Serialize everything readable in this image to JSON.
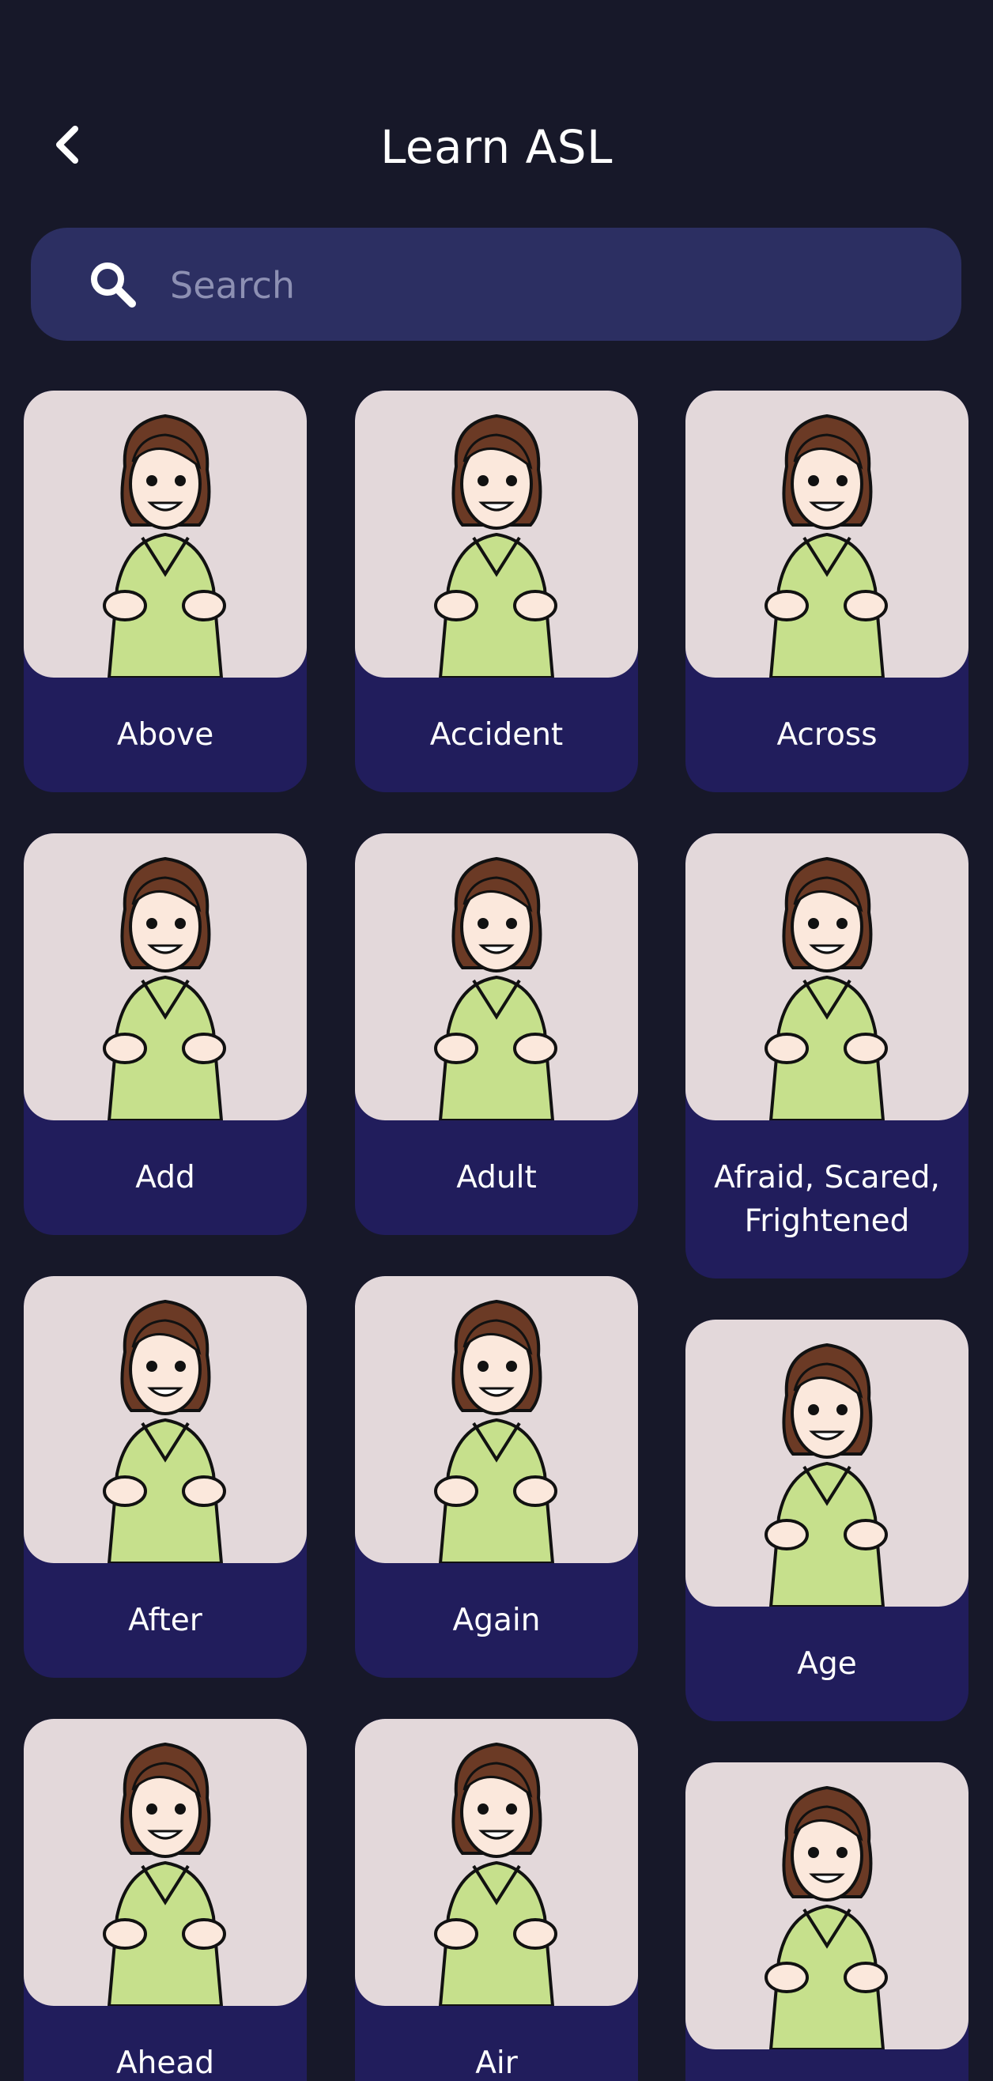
{
  "header": {
    "title": "Learn ASL",
    "back_icon": "chevron-left-icon"
  },
  "search": {
    "placeholder": "Search",
    "value": "",
    "icon": "search-icon"
  },
  "colors": {
    "background": "#171829",
    "search_bg": "#2c2f62",
    "card_bg": "#211d5c",
    "thumb_bg": "#e3d8da",
    "shirt": "#c6e08c",
    "hair": "#6b3a25"
  },
  "signs": [
    {
      "label": "Above"
    },
    {
      "label": "Accident"
    },
    {
      "label": "Across"
    },
    {
      "label": "Add"
    },
    {
      "label": "Adult"
    },
    {
      "label": "Afraid, Scared, Frightened"
    },
    {
      "label": "After"
    },
    {
      "label": "Again"
    },
    {
      "label": "Age"
    },
    {
      "label": "Ahead"
    },
    {
      "label": "Air"
    },
    {
      "label": ""
    }
  ]
}
